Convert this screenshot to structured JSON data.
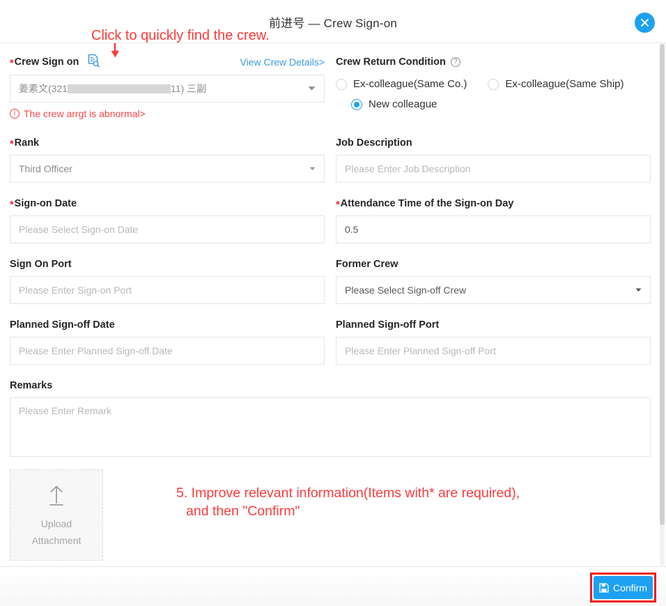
{
  "header": {
    "title": "前进号 — Crew Sign-on",
    "close_icon": "close-icon"
  },
  "annotations": {
    "top": "Click to quickly find the crew.",
    "bottom_line1": "5. Improve relevant information(Items with* are required),",
    "bottom_line2": "and then \"Confirm\"",
    "color": "#fb3b3b"
  },
  "form": {
    "crew_sign_on": {
      "label": "Crew Sign on",
      "required_mark": "*",
      "search_icon": "document-search-icon",
      "view_details_link": "View Crew Details>",
      "value_prefix": "姜素文(321",
      "value_suffix": "11) 三副",
      "error_text": "The crew arrgt is abnormal>"
    },
    "crew_return_condition": {
      "label": "Crew Return Condition",
      "help_icon": "question-circle-icon",
      "options": [
        {
          "label": "Ex-colleague(Same Co.)",
          "checked": false
        },
        {
          "label": "Ex-colleague(Same Ship)",
          "checked": false
        },
        {
          "label": "New colleague",
          "checked": true
        }
      ]
    },
    "rank": {
      "label": "Rank",
      "required_mark": "*",
      "value": "Third Officer"
    },
    "job_description": {
      "label": "Job Description",
      "placeholder": "Please Enter Job Description",
      "value": ""
    },
    "sign_on_date": {
      "label": "Sign-on Date",
      "required_mark": "*",
      "placeholder": "Please Select Sign-on Date",
      "value": ""
    },
    "attendance_time": {
      "label": "Attendance Time of the Sign-on Day",
      "required_mark": "*",
      "value": "0.5"
    },
    "sign_on_port": {
      "label": "Sign On Port",
      "placeholder": "Please Enter Sign-on Port",
      "value": ""
    },
    "former_crew": {
      "label": "Former Crew",
      "value": "Please Select Sign-off Crew"
    },
    "planned_signoff_date": {
      "label": "Planned Sign-off Date",
      "placeholder": "Please Enter Planned Sign-off Date",
      "value": ""
    },
    "planned_signoff_port": {
      "label": "Planned Sign-off Port",
      "placeholder": "Please Enter Planned Sign-off Port",
      "value": ""
    },
    "remarks": {
      "label": "Remarks",
      "placeholder": "Please Enter Remark",
      "value": ""
    },
    "upload": {
      "line1": "Upload",
      "line2": "Attachment",
      "icon": "upload-arrow-icon"
    }
  },
  "footer": {
    "confirm_label": "Confirm",
    "confirm_icon": "save-floppy-icon",
    "accent_color": "#1da1f2",
    "highlight_color": "#ef1c1c"
  }
}
